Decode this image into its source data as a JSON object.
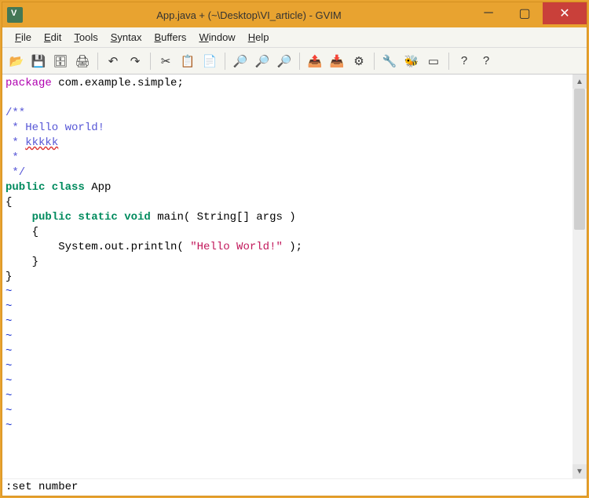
{
  "title": "App.java + (~\\Desktop\\VI_article) - GVIM",
  "menus": {
    "file": "File",
    "edit": "Edit",
    "tools": "Tools",
    "syntax": "Syntax",
    "buffers": "Buffers",
    "window": "Window",
    "help": "Help"
  },
  "toolbar_icons": {
    "open": "📂",
    "save": "💾",
    "saveall": "🗄",
    "print": "🖨",
    "undo": "↶",
    "redo": "↷",
    "cut": "✂",
    "copy": "📋",
    "paste": "📄",
    "find": "🔎",
    "findnext": "🔎",
    "findprev": "🔎",
    "load": "📤",
    "save2": "📥",
    "run": "⚙",
    "make": "🔧",
    "shell": "🐝",
    "tags": "▭",
    "help": "?",
    "findhelp": "?"
  },
  "code": {
    "line1_kw": "package",
    "line1_rest": " com.example.simple;",
    "blank": "",
    "cmt_open": "/**",
    "cmt_hello": " * Hello world!",
    "cmt_kkk_prefix": " * ",
    "cmt_kkk_word": "kkkkk",
    "cmt_star": " *",
    "cmt_close": " */",
    "pub_class": "public class",
    "class_name": " App",
    "brace_open": "{",
    "pub_static_void": "public static void",
    "main_sig": " main( String[] args )",
    "inner_brace_open": "    {",
    "print_prefix": "        System.out.println( ",
    "print_str": "\"Hello World!\"",
    "print_suffix": " );",
    "inner_brace_close": "    }",
    "brace_close": "}",
    "tilde": "~"
  },
  "cmdline": ":set number"
}
